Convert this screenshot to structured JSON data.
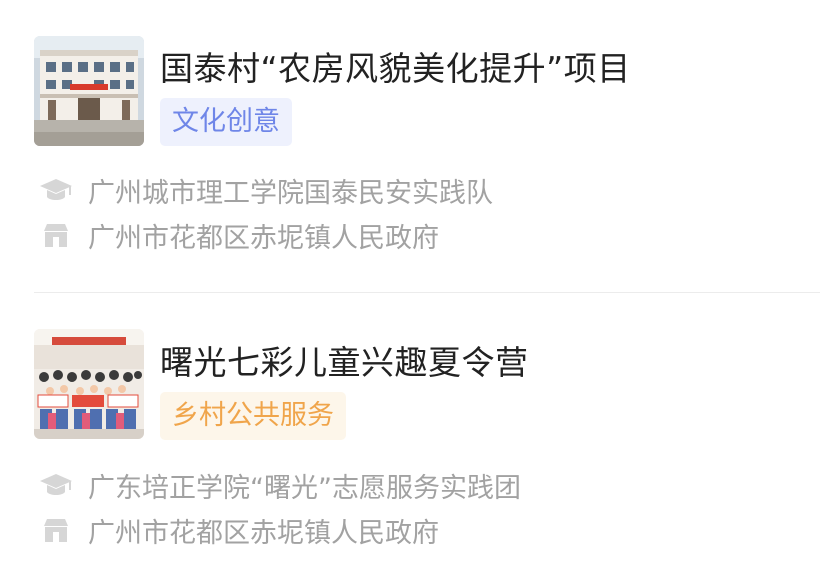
{
  "projects": [
    {
      "title": "国泰村“农房风貌美化提升”项目",
      "tag": "文化创意",
      "team": "广州城市理工学院国泰民安实践队",
      "organization": "广州市花都区赤坭镇人民政府",
      "thumbnail_icon": "building-photo",
      "tag_color": "#6f86e8"
    },
    {
      "title": "曙光七彩儿童兴趣夏令营",
      "tag": "乡村公共服务",
      "team": "广东培正学院“曙光”志愿服务实践团",
      "organization": "广州市花都区赤坭镇人民政府",
      "thumbnail_icon": "group-photo",
      "tag_color": "#f0a54b"
    }
  ],
  "icons": {
    "team": "graduation-cap-icon",
    "organization": "building-icon"
  }
}
